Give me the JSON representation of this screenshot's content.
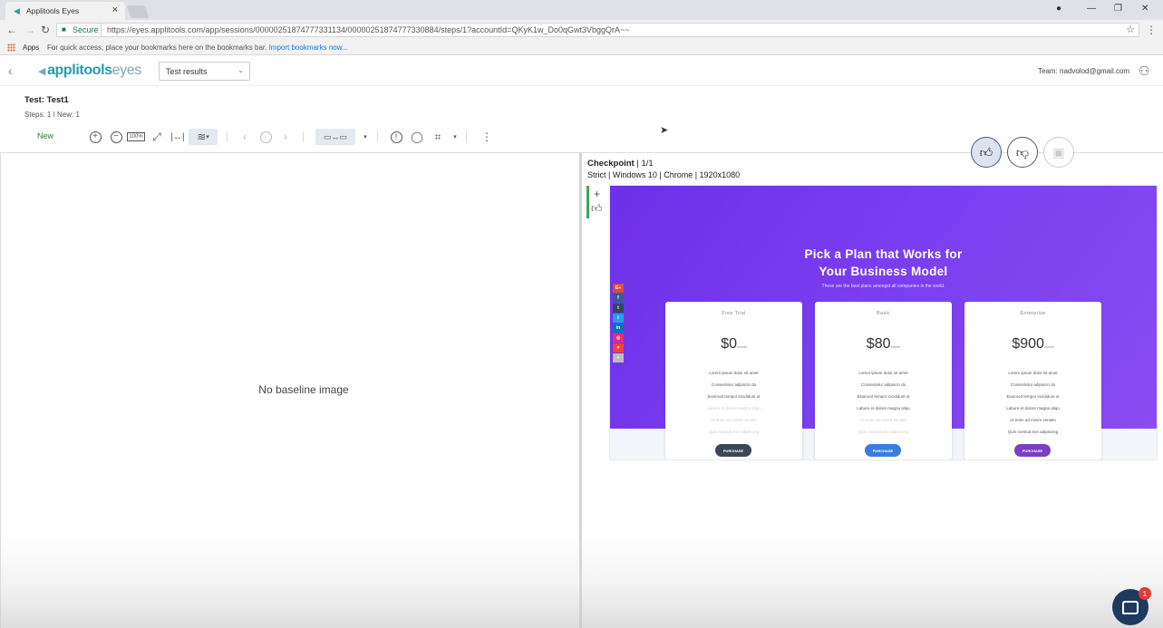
{
  "browser": {
    "tab_title": "Applitools Eyes",
    "secure_label": "Secure",
    "url": "https://eyes.applitools.com/app/sessions/00000251874777331134/00000251874777330884/steps/1?accountId=QKyK1w_Do0qGwt3VbggQrA~~",
    "bookmarks_apps": "Apps",
    "bookmarks_hint": "For quick access, place your bookmarks here on the bookmarks bar.",
    "bookmarks_import": "Import bookmarks now..."
  },
  "header": {
    "logo_part1": "applitools",
    "logo_part2": "eyes",
    "view_select": "Test results",
    "team": "Team: nadvolod@gmail.com"
  },
  "test": {
    "title": "Test: Test1",
    "steps": "Steps: 1  I  New: 1",
    "status": "New"
  },
  "toolbar": {
    "zoom_100": "100%"
  },
  "baseline": {
    "empty_text": "No baseline image"
  },
  "checkpoint": {
    "label": "Checkpoint",
    "count": "| 1/1",
    "details": "Strict | Windows 10 | Chrome | 1920x1080"
  },
  "screenshot": {
    "headline_line1": "Pick a Plan that Works for",
    "headline_line2": "Your Business Model",
    "subtitle": "These are the best plans amongst all companies in the world.",
    "plans": [
      {
        "name": "Free Trial",
        "price": "$0",
        "per": "/month",
        "button": "PURCHASE",
        "color": "#3c4858"
      },
      {
        "name": "Basic",
        "price": "$80",
        "per": "/month",
        "button": "PURCHASE",
        "color": "#3b7ddd"
      },
      {
        "name": "Enterprise",
        "price": "$900",
        "per": "/month",
        "button": "PURCHASE",
        "color": "#7b3fc4"
      }
    ],
    "features_free": [
      "Lorem ipsum dolor sit amet",
      "Consectetur adipiscin do",
      "Eiusmod tempor incididunt ut",
      "Labore et dolore magna aliqu",
      "Ut enim ad minim veniam",
      "Quis nostrud exe adipiscing"
    ],
    "features_basic": [
      "Lorem ipsum dolor sit amet",
      "Consectetur adipiscin do",
      "Eiusmod tempor incididunt ut",
      "Labore et dolore magna aliqu",
      "Ut enim ad minim veniam",
      "Quis nostrud exe adipiscing"
    ],
    "features_ent": [
      "Lorem ipsum dolor sit amet",
      "Consectetur adipiscin do",
      "Eiusmod tempor incididunt ut",
      "Labore et dolore magna aliqu",
      "Ut enim ad minim veniam",
      "Quis nostrud exe adipiscing"
    ],
    "social": [
      "G+",
      "f",
      "t",
      "t",
      "in",
      "◎",
      "♥",
      "+"
    ]
  },
  "chat": {
    "badge": "1"
  },
  "colors": {
    "accent": "#2a9ab0",
    "approve": "#3aa757",
    "hero_purple": "#7a3ff0"
  }
}
